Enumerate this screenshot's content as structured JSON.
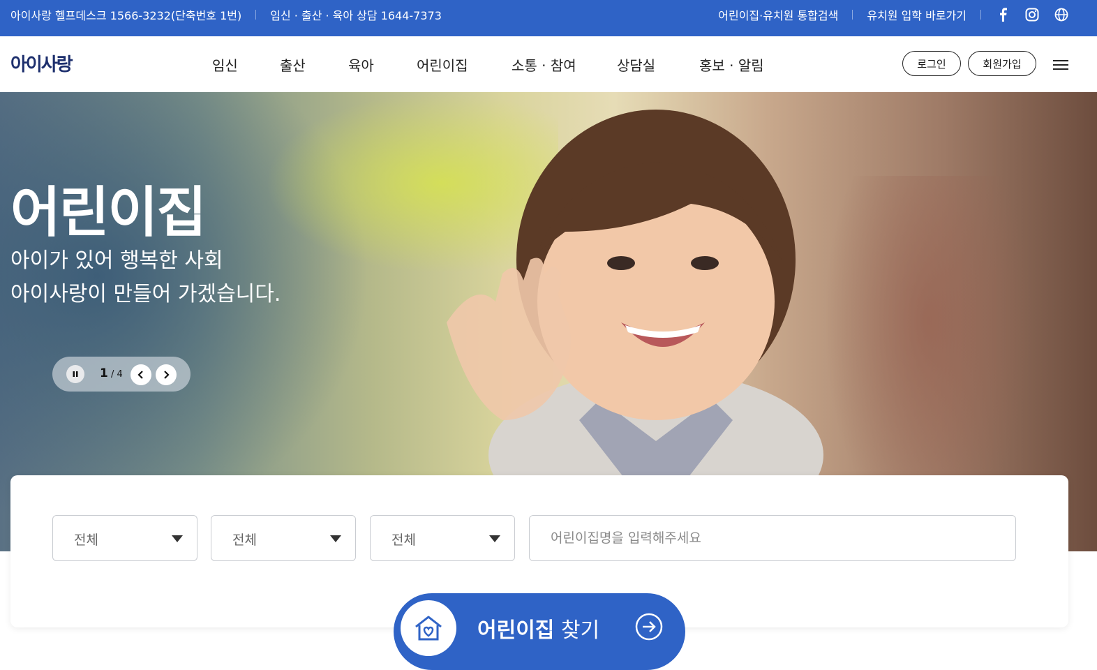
{
  "topbar": {
    "helpdesk": "아이사랑 헬프데스크 1566-3232(단축번호 1번)",
    "consult": "임신 · 출산 · 육아 상담 1644-7373",
    "integrated_search": "어린이집·유치원 통합검색",
    "kinder_link": "유치원 입학 바로가기",
    "icons": [
      "facebook-icon",
      "instagram-icon",
      "globe-icon"
    ]
  },
  "header": {
    "logo": "아이사랑",
    "nav": [
      "임신",
      "출산",
      "육아",
      "어린이집",
      "소통 · 참여",
      "상담실",
      "홍보 · 알림"
    ],
    "login": "로그인",
    "signup": "회원가입"
  },
  "hero": {
    "title": "어린이집",
    "subtitle_line1": "아이가 있어 행복한 사회",
    "subtitle_line2": "아이사랑이 만들어 가겠습니다.",
    "slide_current": "1",
    "slide_total": "4"
  },
  "search": {
    "select1": "전체",
    "select2": "전체",
    "select3": "전체",
    "placeholder": "어린이집명을 입력해주세요",
    "button_bold": "어린이집",
    "button_rest": " 찾기"
  },
  "colors": {
    "brand_blue": "#2f63c6",
    "logo_navy": "#1d2f6d"
  }
}
